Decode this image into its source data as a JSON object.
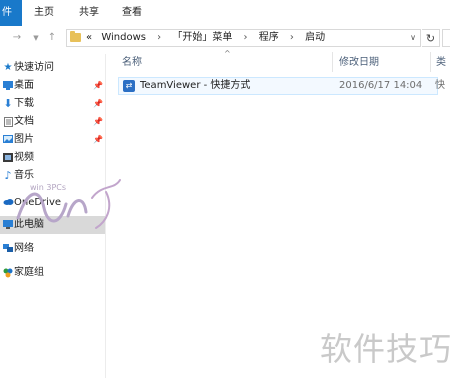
{
  "ribbon": {
    "file": "件",
    "home": "主页",
    "share": "共享",
    "view": "查看"
  },
  "address": {
    "fwd_icon": "forward-arrow-icon",
    "crumbs": [
      "«",
      "Windows",
      "「开始」菜单",
      "程序",
      "启动"
    ]
  },
  "nav": {
    "quick_access": "快速访问",
    "desktop": "桌面",
    "downloads": "下载",
    "documents": "文档",
    "pictures": "图片",
    "videos": "视频",
    "music": "音乐",
    "onedrive": "OneDrive",
    "this_pc": "此电脑",
    "network": "网络",
    "homegroup": "家庭组"
  },
  "columns": {
    "name": "名称",
    "date": "修改日期",
    "type": "类"
  },
  "files": [
    {
      "name": "TeamViewer - 快捷方式",
      "date": "2016/6/17 14:04",
      "type": "快"
    }
  ],
  "watermark": {
    "brand": "软件技巧",
    "sticker": "win 3PCs"
  },
  "colors": {
    "file_tab": "#1979ca",
    "selected_row": "#cce8ff",
    "nav_selected": "#d9d9d9"
  }
}
